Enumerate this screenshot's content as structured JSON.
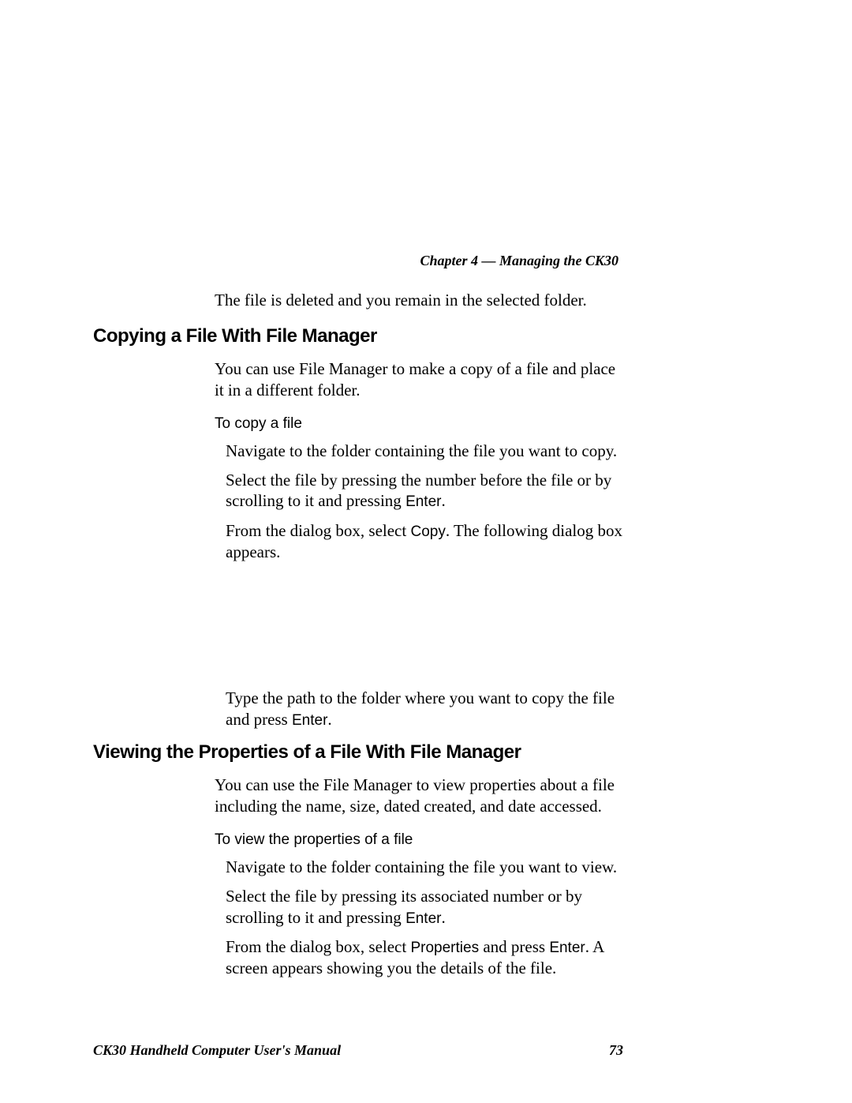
{
  "chapter_header": "Chapter 4 — Managing the CK30",
  "intro_line": "The file is deleted and you remain in the selected folder.",
  "section_a": {
    "heading": "Copying a File With File Manager",
    "body": "You can use File Manager to make a copy of a file and place it in a different folder.",
    "subheading": "To copy a file",
    "steps": {
      "s1": "Navigate to the folder containing the file you want to copy.",
      "s2a": "Select the file by pressing the number before the file or by scrolling to it and pressing ",
      "s2b": "Enter",
      "s2c": ".",
      "s3a": "From the dialog box, select ",
      "s3b": "Copy",
      "s3c": ". The following dialog box appears.",
      "s4a": "Type the path to the folder where you want to copy the file and press ",
      "s4b": "Enter",
      "s4c": "."
    }
  },
  "section_b": {
    "heading": "Viewing the Properties of a File With File Manager",
    "body": "You can use the File Manager to view properties about a file including the name, size, dated created, and date accessed.",
    "subheading": "To view the properties of a file",
    "steps": {
      "s1": "Navigate to the folder containing the file you want to view.",
      "s2a": "Select the file by pressing its associated number or by scrolling to it and pressing ",
      "s2b": "Enter",
      "s2c": ".",
      "s3a": "From the dialog box, select ",
      "s3b": "Properties",
      "s3c": " and press ",
      "s3d": "Enter",
      "s3e": ". A screen appears showing you the details of the file."
    }
  },
  "footer": {
    "title": "CK30 Handheld Computer User's Manual",
    "page": "73"
  }
}
